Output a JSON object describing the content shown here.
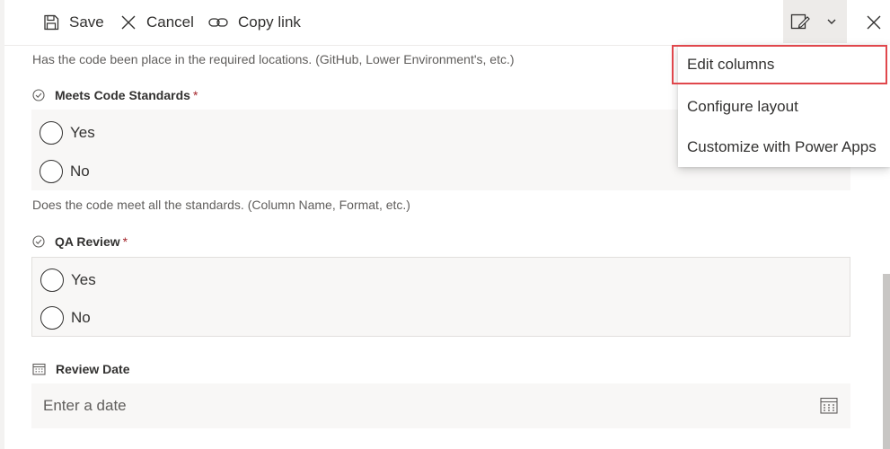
{
  "toolbar": {
    "save_label": "Save",
    "cancel_label": "Cancel",
    "copy_link_label": "Copy link"
  },
  "fields": {
    "prev_description": "Has the code been place in the required locations. (GitHub, Lower Environment's, etc.)",
    "meets_standards": {
      "label": "Meets Code Standards",
      "required_mark": "*",
      "options": [
        "Yes",
        "No"
      ],
      "description": "Does the code meet all the standards. (Column Name, Format, etc.)"
    },
    "qa_review": {
      "label": "QA Review",
      "required_mark": "*",
      "options": [
        "Yes",
        "No"
      ]
    },
    "review_date": {
      "label": "Review Date",
      "placeholder": "Enter a date"
    }
  },
  "menu": {
    "items": [
      "Edit columns",
      "Configure layout",
      "Customize with Power Apps"
    ],
    "highlighted_index": 0
  },
  "colors": {
    "highlight_border": "#e0474c",
    "required": "#a4262c",
    "field_bg": "#f8f7f6"
  },
  "icons": [
    "save-icon",
    "cancel-icon",
    "link-icon",
    "edit-form-icon",
    "chevron-down-icon",
    "close-icon",
    "choice-check-icon",
    "calendar-icon"
  ]
}
